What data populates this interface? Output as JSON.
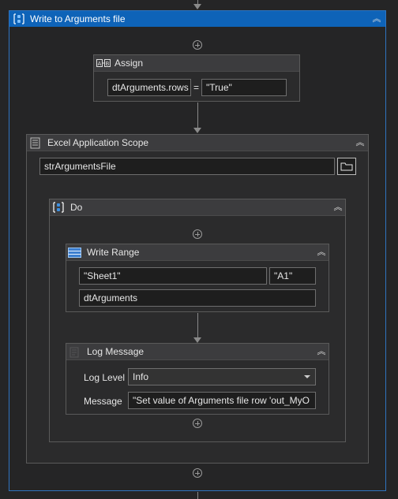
{
  "sequence": {
    "title": "Write to Arguments file"
  },
  "assign": {
    "title": "Assign",
    "left_value": "dtArguments.rows",
    "operator": "=",
    "right_value": "\"True\""
  },
  "excel_scope": {
    "title": "Excel Application Scope",
    "file_path": "strArgumentsFile"
  },
  "do": {
    "title": "Do"
  },
  "write_range": {
    "title": "Write Range",
    "sheet": "\"Sheet1\"",
    "cell": "\"A1\"",
    "data_table": "dtArguments"
  },
  "log_message": {
    "title": "Log Message",
    "level_label": "Log Level",
    "level_value": "Info",
    "message_label": "Message",
    "message_value": "\"Set value of Arguments file row 'out_MyO"
  },
  "icons": {
    "collapse": "double-chevron-up-icon",
    "sequence": "sequence-icon",
    "assign": "assign-icon",
    "excel": "excel-scope-icon",
    "write_range": "table-icon",
    "log": "log-icon",
    "folder": "folder-icon"
  },
  "colors": {
    "accent": "#0e63b8",
    "background": "#252526",
    "card": "#2b2b2c"
  }
}
